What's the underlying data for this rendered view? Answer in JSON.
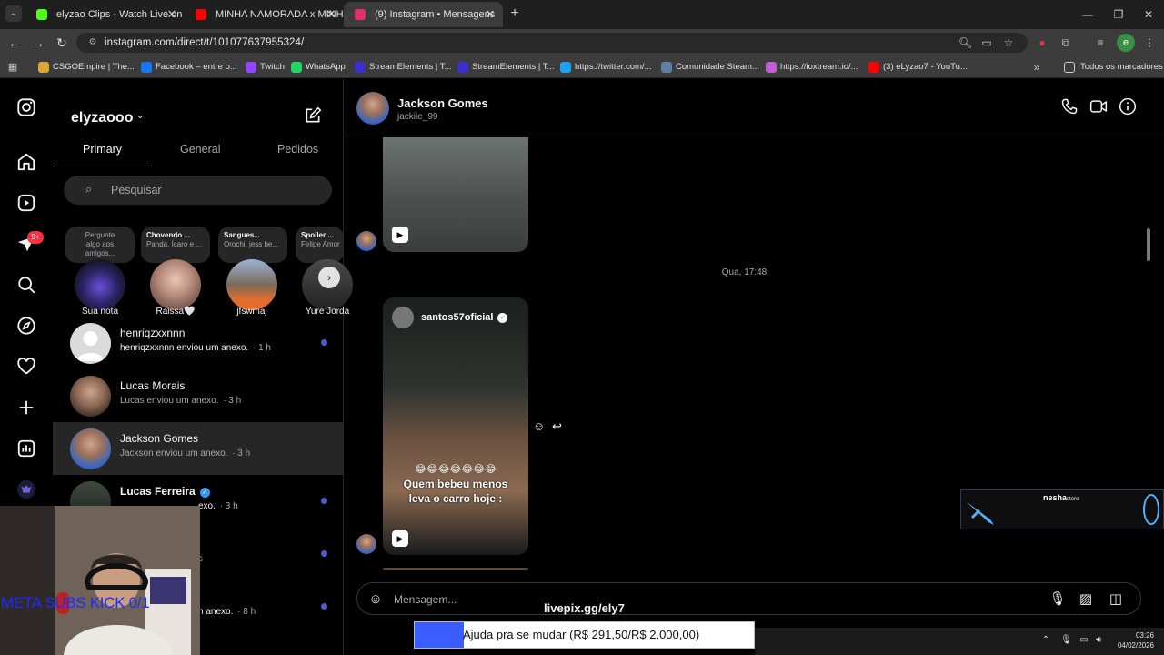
{
  "browser": {
    "tabs": [
      {
        "title": "elyzao Clips - Watch Live on Kic",
        "color": "#53fc18"
      },
      {
        "title": "MINHA NAMORADA x MINHA",
        "color": "#ff0000"
      },
      {
        "title": "(9) Instagram • Mensagens",
        "color": "#e1306c"
      }
    ],
    "url": "instagram.com/direct/t/101077637955324/",
    "profile_initial": "e",
    "bookmarks": [
      {
        "label": "CSGOEmpire | The...",
        "color": "#d9a637"
      },
      {
        "label": "Facebook – entre o...",
        "color": "#1877f2"
      },
      {
        "label": "Twitch",
        "color": "#9146ff"
      },
      {
        "label": "WhatsApp",
        "color": "#25d366"
      },
      {
        "label": "StreamElements | T...",
        "color": "#3b2fc9"
      },
      {
        "label": "StreamElements | T...",
        "color": "#3b2fc9"
      },
      {
        "label": "https://twitter.com/...",
        "color": "#1da1f2"
      },
      {
        "label": "Comunidade Steam...",
        "color": "#5d7fa8"
      },
      {
        "label": "https://ioxtream.io/...",
        "color": "#c05ed6"
      },
      {
        "label": "(3) eLyzao7 - YouTu...",
        "color": "#ff0000"
      }
    ],
    "all_bookmarks": "Todos os marcadores"
  },
  "rail": {
    "notification_badge": "9+"
  },
  "inbox": {
    "account": "elyzaooo",
    "tabs": [
      "Primary",
      "General",
      "Pedidos"
    ],
    "search_placeholder": "Pesquisar",
    "notes": [
      {
        "l1": "Pergunte",
        "l2": "algo aos",
        "l3": "amigos..."
      },
      {
        "title": "Chovendo ...",
        "sub": "Panda, Ícaro e ..."
      },
      {
        "title": "Sangues...",
        "sub": "Orochi, jess be..."
      },
      {
        "title": "Spoiler ...",
        "sub": "Felipe Amor"
      }
    ],
    "stories": [
      "Sua nota",
      "Raissa🤍",
      "jfswmaj",
      "Yure Jorda"
    ],
    "conversations": [
      {
        "name": "henriqzxxnnn",
        "preview": "henriqzxxnnn enviou um anexo.",
        "time": "· 1 h"
      },
      {
        "name": "Lucas Morais",
        "preview": "Lucas enviou um anexo.",
        "time": "· 3 h"
      },
      {
        "name": "Jackson Gomes",
        "preview": "Jackson enviou um anexo.",
        "time": "· 3 h"
      },
      {
        "name": "Lucas Ferreira",
        "preview": "exo.",
        "time": "· 3 h"
      },
      {
        "preview": "s"
      },
      {
        "preview": "n anexo.",
        "time": "· 8 h"
      }
    ]
  },
  "stream_overlay": {
    "goal_text": "META SUBS KICK 0/1"
  },
  "chat": {
    "name": "Jackson Gomes",
    "username": "jackiie_99",
    "timestamp": "Qua, 17:48",
    "post": {
      "author": "santos57oficial",
      "emoji_line": "😂😂😂😂😂😂😂",
      "caption_l1": "Quem bebeu menos",
      "caption_l2": "leva o carro hoje :"
    },
    "composer_placeholder": "Mensagem..."
  },
  "nesha": {
    "brand": "nesha",
    "brand_suffix": "store"
  },
  "donation": {
    "site": "livepix.gg/ely7",
    "goal_label": "Ajuda pra se mudar (R$ 291,50/R$ 2.000,00)",
    "progress": 0.1457
  },
  "taskbar": {
    "time": "03:26",
    "date": "04/02/2026"
  }
}
